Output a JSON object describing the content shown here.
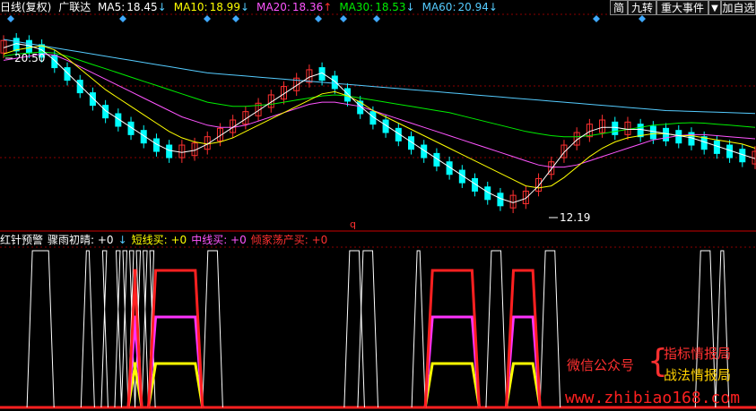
{
  "header": {
    "period": "日线(复权)",
    "stock": "广联达",
    "ma": [
      {
        "label": "MA5:",
        "value": "18.45",
        "arrow": "↓",
        "color": "#ffffff"
      },
      {
        "label": "MA10:",
        "value": "18.99",
        "arrow": "↓",
        "color": "#ffff00"
      },
      {
        "label": "MA20:",
        "value": "18.36",
        "arrow": "↑",
        "color": "#ff55ff"
      },
      {
        "label": "MA30:",
        "value": "18.53",
        "arrow": "↓",
        "color": "#00ee00"
      },
      {
        "label": "MA60:",
        "value": "20.94",
        "arrow": "↓",
        "color": "#55ccff"
      }
    ]
  },
  "buttons": {
    "simplified": "简",
    "nine_turn": "九转",
    "events": "重大事件",
    "dropdown": "▼",
    "add_watch": "加自选"
  },
  "price_labels": {
    "high": "20.50",
    "low": "12.19",
    "marker": "q"
  },
  "sub_header": {
    "items": [
      {
        "text": "红针预警",
        "color": "#ffffff"
      },
      {
        "text": "骤雨初晴: +0",
        "color": "#ffffff"
      },
      {
        "text": "↓",
        "color": "#55ccff"
      },
      {
        "text": "短线买: +0",
        "color": "#ffff00"
      },
      {
        "text": "中线买: +0",
        "color": "#ff55ff"
      },
      {
        "text": "倾家荡产买: +0",
        "color": "#ff3030"
      }
    ]
  },
  "watermark": {
    "account": "微信公众号",
    "line1": "指标情报局",
    "line2": "战法情报局",
    "url": "www.zhibiao168.com"
  },
  "colors": {
    "up": "#ff3030",
    "down": "#00ffff",
    "ma5": "#ffffff",
    "ma10": "#ffff00",
    "ma20": "#ff55ff",
    "ma30": "#00ee00",
    "ma60": "#55ccff",
    "grid": "#8b0000"
  },
  "chart_data": [
    {
      "type": "line",
      "series": [
        {
          "name": "MA60",
          "values": [
            20.6,
            20.5,
            20.4,
            20.3,
            20.2,
            20.1,
            20.0,
            19.9,
            19.8,
            19.7,
            19.6,
            19.5,
            19.4,
            19.3,
            19.2,
            19.1,
            19.0,
            18.95,
            18.9,
            18.85,
            18.8,
            18.75,
            18.7,
            18.65,
            18.6,
            18.55,
            18.5,
            18.45,
            18.4,
            18.35,
            18.3,
            18.25,
            18.2,
            18.15,
            18.1,
            18.05,
            18.0,
            17.95,
            17.9,
            17.85,
            17.8,
            17.75,
            17.7,
            17.65,
            17.6,
            17.55,
            17.5,
            17.45,
            17.4,
            17.35,
            17.3,
            17.25,
            17.2,
            17.18,
            17.16,
            17.14,
            17.12,
            17.1,
            17.08,
            17.06
          ]
        },
        {
          "name": "MA30",
          "values": [
            19.8,
            19.9,
            19.95,
            20.0,
            19.95,
            19.8,
            19.6,
            19.4,
            19.2,
            19.0,
            18.8,
            18.6,
            18.4,
            18.2,
            18.0,
            17.8,
            17.6,
            17.5,
            17.4,
            17.4,
            17.45,
            17.5,
            17.6,
            17.7,
            17.8,
            17.9,
            17.95,
            17.9,
            17.8,
            17.7,
            17.6,
            17.5,
            17.4,
            17.3,
            17.2,
            17.1,
            16.95,
            16.8,
            16.65,
            16.5,
            16.35,
            16.2,
            16.1,
            16.0,
            15.95,
            15.95,
            16.0,
            16.1,
            16.2,
            16.3,
            16.4,
            16.5,
            16.55,
            16.6,
            16.62,
            16.6,
            16.55,
            16.5,
            16.45,
            16.4
          ]
        },
        {
          "name": "MA20",
          "values": [
            19.6,
            19.7,
            19.8,
            19.9,
            19.85,
            19.6,
            19.3,
            19.0,
            18.7,
            18.4,
            18.1,
            17.8,
            17.5,
            17.2,
            16.9,
            16.7,
            16.5,
            16.4,
            16.4,
            16.5,
            16.7,
            16.9,
            17.1,
            17.3,
            17.5,
            17.6,
            17.6,
            17.5,
            17.4,
            17.2,
            17.0,
            16.8,
            16.6,
            16.4,
            16.2,
            16.0,
            15.8,
            15.6,
            15.4,
            15.2,
            15.0,
            14.8,
            14.6,
            14.5,
            14.5,
            14.6,
            14.8,
            15.0,
            15.2,
            15.4,
            15.6,
            15.8,
            15.9,
            16.0,
            16.05,
            16.05,
            16.0,
            15.95,
            15.9,
            15.85
          ]
        },
        {
          "name": "MA10",
          "values": [
            19.9,
            20.1,
            20.2,
            20.3,
            20.1,
            19.7,
            19.2,
            18.7,
            18.2,
            17.8,
            17.4,
            17.0,
            16.6,
            16.2,
            15.9,
            15.7,
            15.6,
            15.7,
            15.9,
            16.2,
            16.5,
            16.8,
            17.1,
            17.4,
            17.7,
            18.0,
            18.1,
            17.9,
            17.6,
            17.2,
            16.9,
            16.6,
            16.3,
            16.0,
            15.7,
            15.4,
            15.1,
            14.8,
            14.5,
            14.2,
            13.9,
            13.6,
            13.5,
            13.6,
            14.0,
            14.5,
            15.0,
            15.4,
            15.7,
            15.9,
            16.0,
            16.1,
            16.1,
            16.0,
            16.0,
            15.9,
            15.8,
            15.7,
            15.6,
            15.4
          ]
        },
        {
          "name": "MA5",
          "values": [
            20.2,
            20.4,
            20.3,
            20.1,
            19.6,
            19.0,
            18.4,
            17.8,
            17.2,
            16.8,
            16.4,
            16.0,
            15.6,
            15.3,
            15.2,
            15.3,
            15.6,
            16.0,
            16.4,
            16.8,
            17.2,
            17.6,
            18.0,
            18.4,
            18.8,
            19.0,
            18.6,
            18.0,
            17.4,
            16.9,
            16.5,
            16.1,
            15.7,
            15.3,
            14.9,
            14.5,
            14.1,
            13.7,
            13.3,
            13.0,
            12.8,
            13.0,
            13.6,
            14.4,
            15.2,
            15.8,
            16.2,
            16.4,
            16.4,
            16.3,
            16.3,
            16.2,
            16.1,
            16.0,
            15.9,
            15.7,
            15.5,
            15.3,
            15.1,
            14.9
          ]
        }
      ],
      "annotations": [
        "20.50",
        "12.19",
        "q"
      ]
    },
    {
      "type": "line",
      "y_levels": [
        "0",
        "1",
        "2",
        "3",
        "4"
      ],
      "series": [
        {
          "name": "骤雨初晴",
          "pulses": [
            [
              4,
              8
            ],
            [
              12,
              14
            ],
            [
              15,
              16
            ],
            [
              17,
              18
            ],
            [
              18,
              19
            ],
            [
              19,
              20
            ],
            [
              20,
              21
            ],
            [
              21,
              22
            ],
            [
              22,
              23
            ],
            [
              30,
              33
            ],
            [
              51,
              54
            ],
            [
              53,
              56
            ],
            [
              61,
              63
            ],
            [
              72,
              75
            ],
            [
              80,
              83
            ],
            [
              103,
              106
            ],
            [
              106,
              108
            ]
          ]
        },
        {
          "name": "短线买",
          "pulses": [
            [
              19,
              21
            ],
            [
              22,
              30
            ],
            [
              63,
              71
            ],
            [
              75,
              80
            ]
          ]
        },
        {
          "name": "中线买",
          "pulses": [
            [
              19,
              21
            ],
            [
              22,
              30
            ],
            [
              63,
              71
            ],
            [
              75,
              80
            ]
          ]
        },
        {
          "name": "倾家荡产买",
          "pulses": [
            [
              19,
              21
            ],
            [
              22,
              30
            ],
            [
              63,
              71
            ],
            [
              75,
              80
            ]
          ]
        }
      ]
    }
  ]
}
